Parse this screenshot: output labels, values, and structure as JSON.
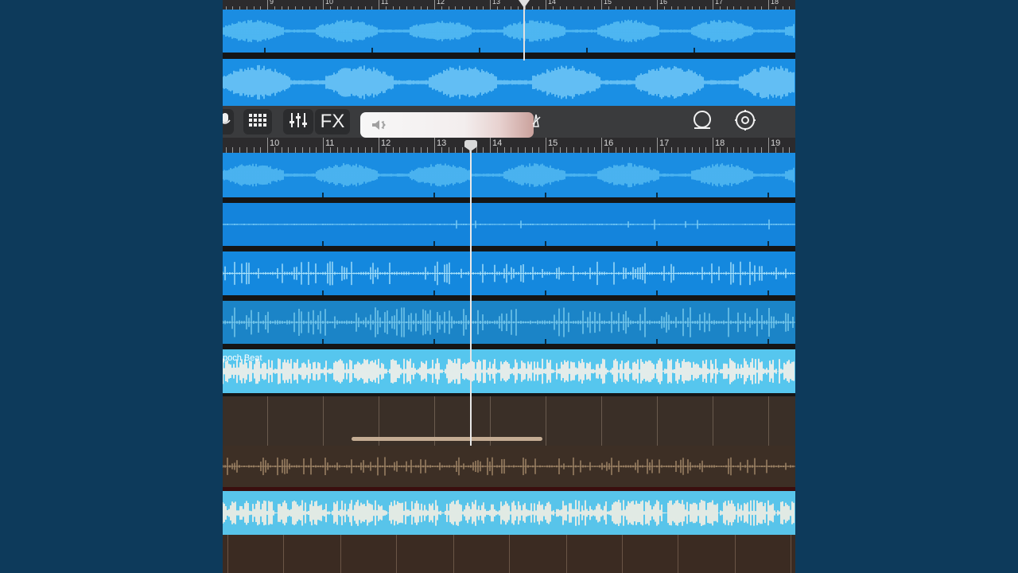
{
  "ruler_top": {
    "labels": [
      "9",
      "10",
      "11",
      "12",
      "13",
      "14",
      "15",
      "16",
      "17",
      "18"
    ]
  },
  "ruler_main": {
    "labels": [
      "10",
      "11",
      "12",
      "13",
      "14",
      "15",
      "16",
      "17",
      "18",
      "19"
    ]
  },
  "toolbar": {
    "fx_label": "FX",
    "mic_icon": "microphone-icon",
    "grid_icon": "grid-icon",
    "mixer_icon": "mixer-sliders-icon",
    "volume_icon": "speaker-muted-icon",
    "loop_icon": "loop-icon",
    "settings_icon": "gear-icon"
  },
  "tracks": [
    {
      "name": ""
    },
    {
      "name": ""
    },
    {
      "name": ""
    },
    {
      "name": ""
    },
    {
      "name": "poch Beat"
    }
  ],
  "colors": {
    "region_blue": "#1383d8",
    "region_light": "#4ab8ea",
    "wave_light": "#9fe0ff",
    "beat_region": "#55c7ee",
    "beat_wave": "#f3f1e9",
    "ruler_bg": "#2c2b2d",
    "empty_track": "#3a2f27"
  }
}
